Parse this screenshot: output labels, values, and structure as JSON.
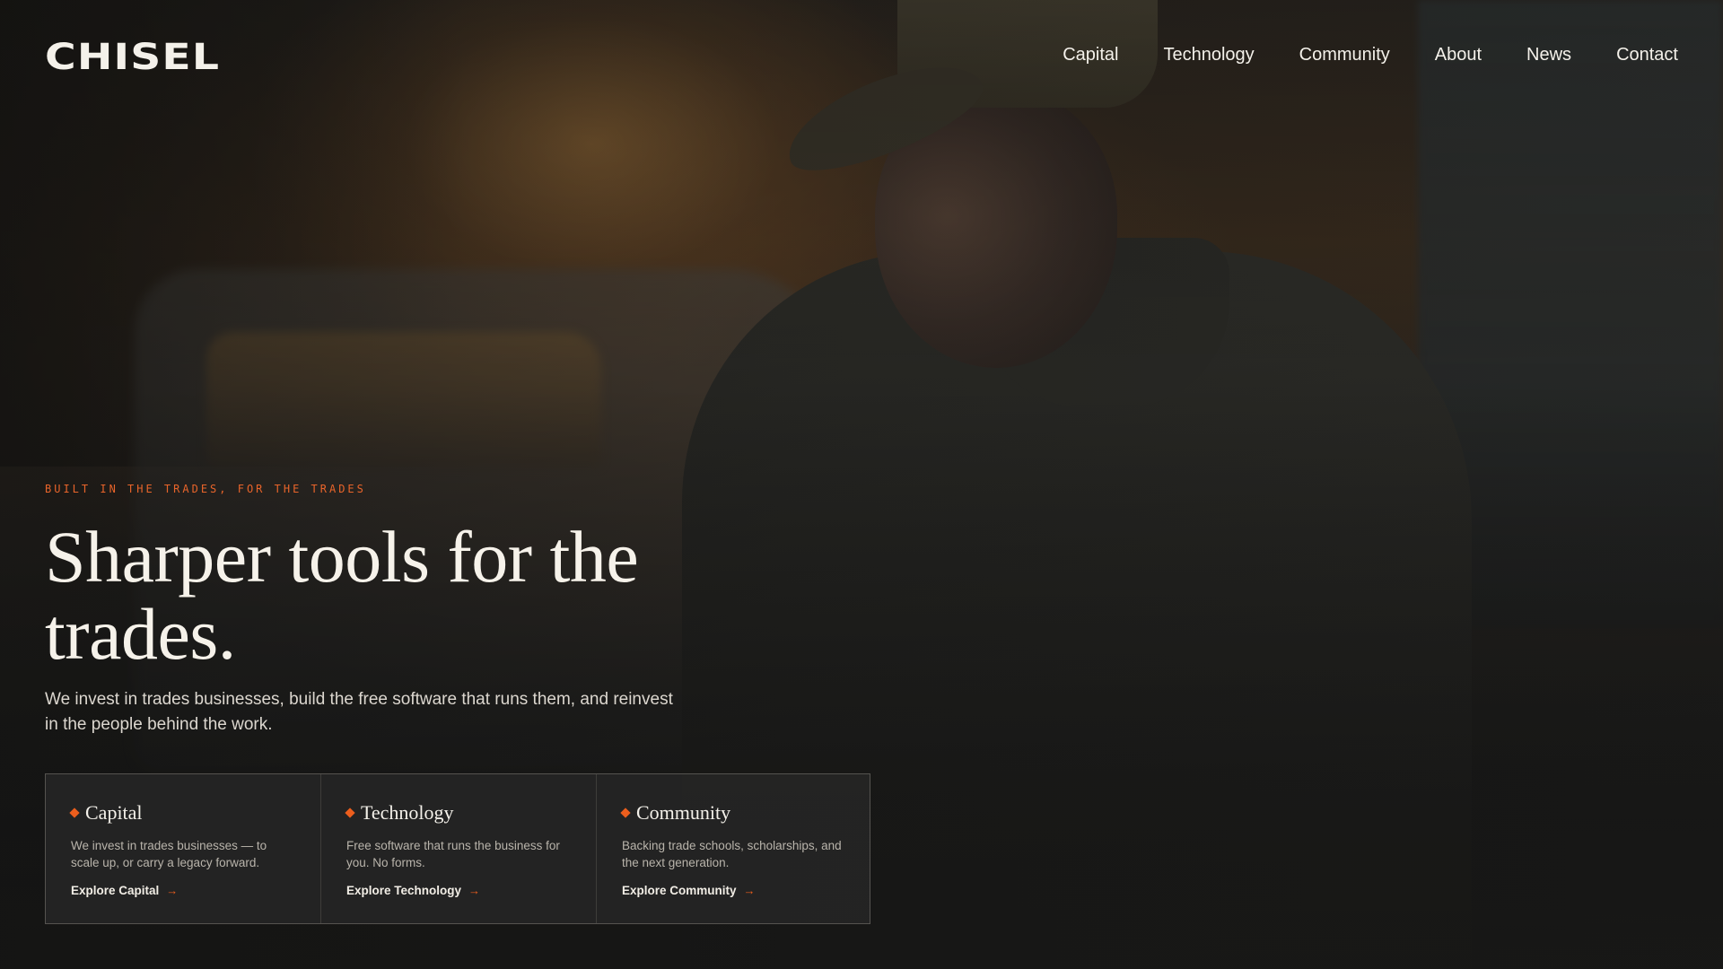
{
  "brand": {
    "logo_text": "CHISEL",
    "accent_color": "#ec5e1d"
  },
  "nav": {
    "items": [
      {
        "label": "Capital"
      },
      {
        "label": "Technology"
      },
      {
        "label": "Community"
      },
      {
        "label": "About"
      },
      {
        "label": "News"
      },
      {
        "label": "Contact"
      }
    ]
  },
  "hero": {
    "eyebrow": "BUILT IN THE TRADES, FOR THE TRADES",
    "headline": "Sharper tools for the trades.",
    "subhead": "We invest in trades businesses, build the free software that runs them, and reinvest in the people behind the work."
  },
  "cards": [
    {
      "title": "Capital",
      "description": "We invest in trades businesses — to scale up, or carry a legacy forward.",
      "link": "Explore Capital",
      "icon": "diamond-icon"
    },
    {
      "title": "Technology",
      "description": "Free software that runs the business for you. No forms.",
      "link": "Explore Technology",
      "icon": "diamond-icon"
    },
    {
      "title": "Community",
      "description": "Backing trade schools, scholarships, and the next generation.",
      "link": "Explore Community",
      "icon": "diamond-icon"
    }
  ]
}
